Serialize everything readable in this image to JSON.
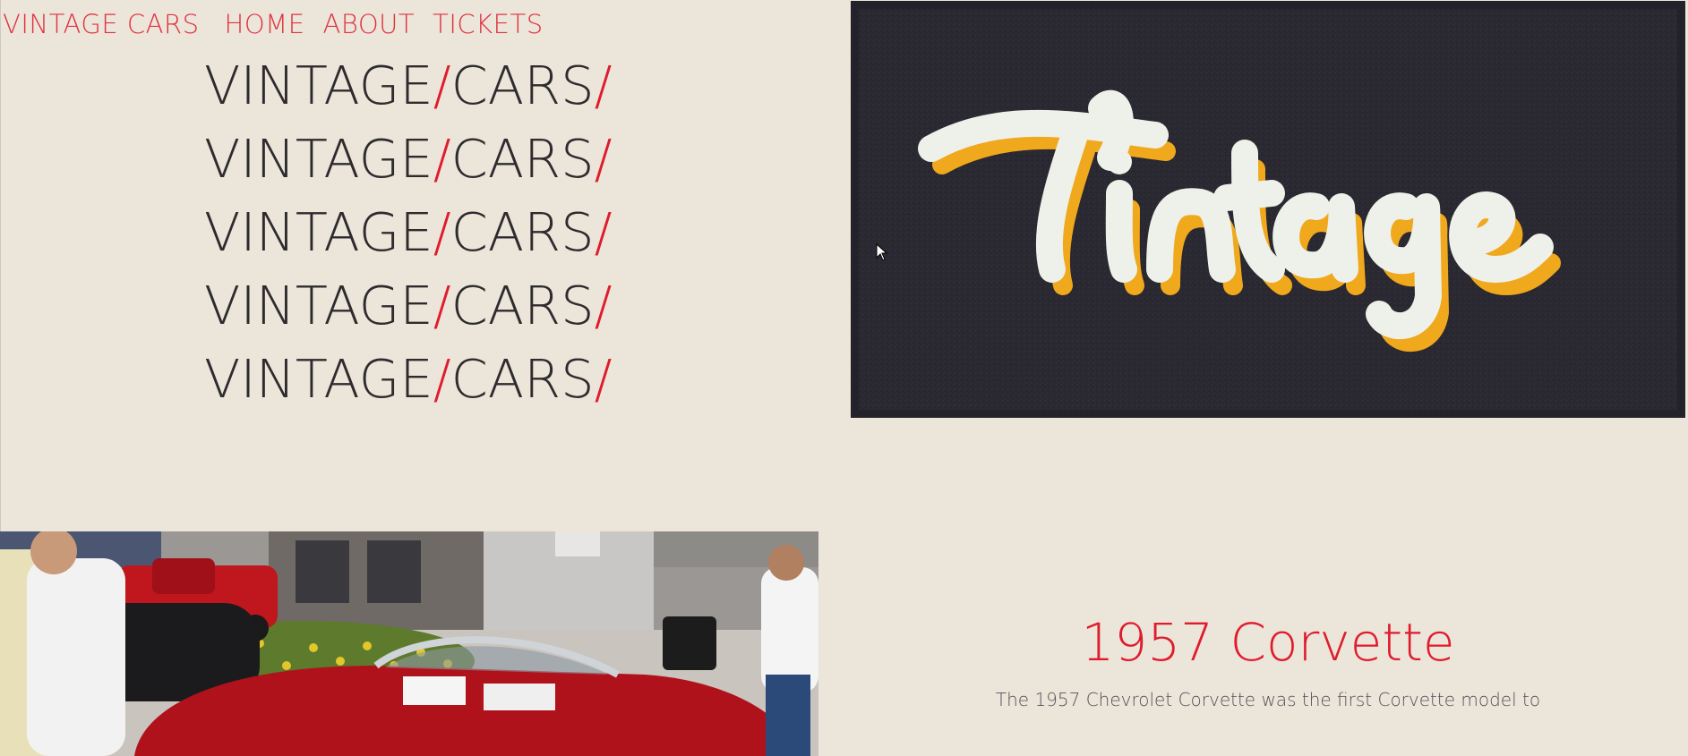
{
  "nav": {
    "brand": "VINTAGE CARS",
    "links": [
      "HOME",
      "ABOUT",
      "TICKETS"
    ]
  },
  "hero": {
    "lines": [
      {
        "word1": "VINTAGE",
        "sep1": "/",
        "word2": "CARS",
        "sep2": "/"
      },
      {
        "word1": "VINTAGE",
        "sep1": "/",
        "word2": "CARS",
        "sep2": "/"
      },
      {
        "word1": "VINTAGE",
        "sep1": "/",
        "word2": "CARS",
        "sep2": "/"
      },
      {
        "word1": "VINTAGE",
        "sep1": "/",
        "word2": "CARS",
        "sep2": "/"
      },
      {
        "word1": "VINTAGE",
        "sep1": "/",
        "word2": "CARS",
        "sep2": "/"
      }
    ]
  },
  "banner": {
    "logo_text": "Vintage"
  },
  "article": {
    "title": "1957 Corvette",
    "body": "The 1957 Chevrolet Corvette was the first Corvette model to"
  },
  "colors": {
    "background": "#ebe5da",
    "accent": "#e01b2c",
    "text_dark": "#2d2b2d",
    "banner_bg": "#2a2830",
    "logo_cream": "#eef0ea",
    "logo_gold": "#f0a81c"
  }
}
